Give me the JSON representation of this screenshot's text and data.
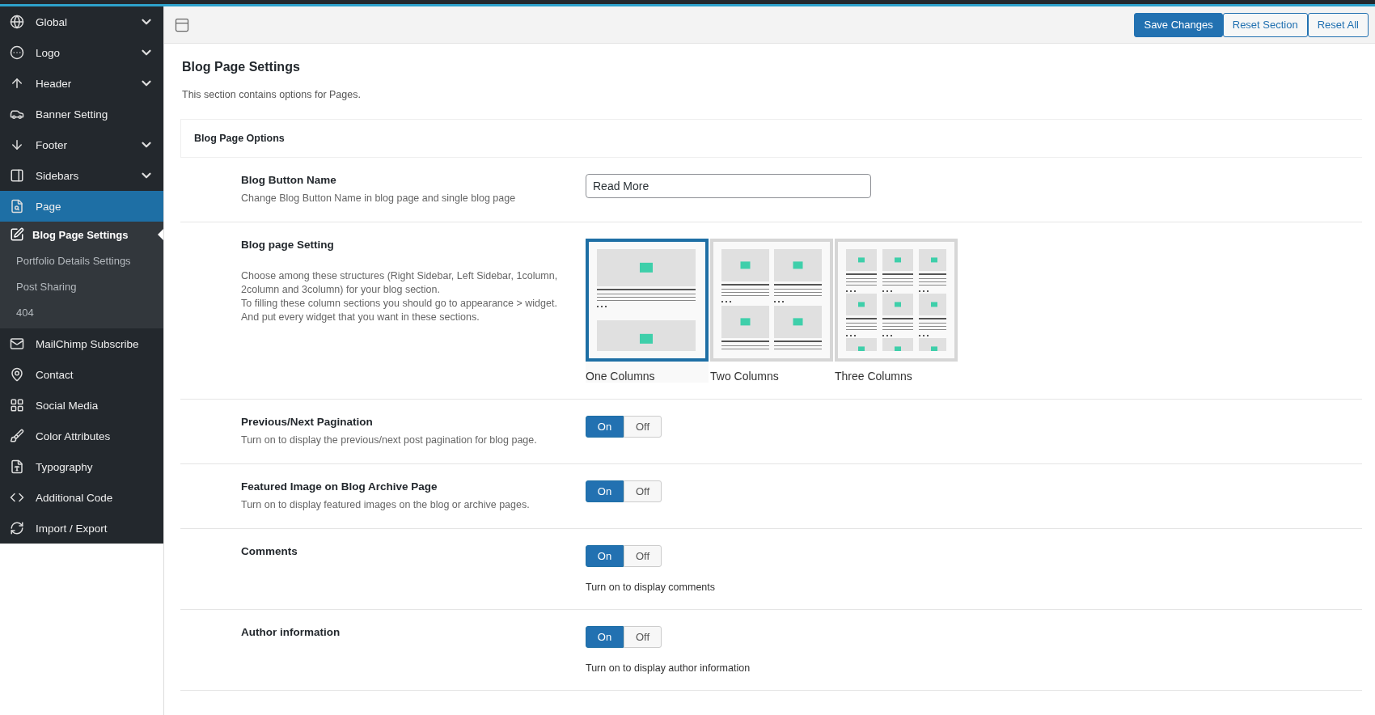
{
  "sidebar": {
    "items": [
      {
        "label": "Global",
        "expandable": true,
        "selected": false
      },
      {
        "label": "Logo",
        "expandable": true,
        "selected": false
      },
      {
        "label": "Header",
        "expandable": true,
        "selected": false
      },
      {
        "label": "Banner Setting",
        "expandable": false,
        "selected": false
      },
      {
        "label": "Footer",
        "expandable": true,
        "selected": false
      },
      {
        "label": "Sidebars",
        "expandable": true,
        "selected": false
      },
      {
        "label": "Page",
        "expandable": false,
        "selected": true,
        "children": [
          {
            "label": "Blog Page Settings",
            "selected": true
          },
          {
            "label": "Portfolio Details Settings",
            "selected": false
          },
          {
            "label": "Post Sharing",
            "selected": false
          },
          {
            "label": "404",
            "selected": false
          }
        ]
      },
      {
        "label": "MailChimp Subscribe",
        "expandable": false,
        "selected": false
      },
      {
        "label": "Contact",
        "expandable": false,
        "selected": false
      },
      {
        "label": "Social Media",
        "expandable": false,
        "selected": false
      },
      {
        "label": "Color Attributes",
        "expandable": false,
        "selected": false
      },
      {
        "label": "Typography",
        "expandable": false,
        "selected": false
      },
      {
        "label": "Additional Code",
        "expandable": false,
        "selected": false
      },
      {
        "label": "Import / Export",
        "expandable": false,
        "selected": false
      }
    ]
  },
  "toolbar": {
    "buttons": [
      {
        "label": "Save Changes",
        "kind": "primary"
      },
      {
        "label": "Reset Section",
        "kind": "secondary"
      },
      {
        "label": "Reset All",
        "kind": "secondary"
      }
    ]
  },
  "section": {
    "title": "Blog Page Settings",
    "description": "This section contains options for Pages.",
    "group": "Blog Page Options"
  },
  "settings": [
    {
      "kind": "text",
      "title": "Blog Button Name",
      "description": [
        "Change Blog Button Name in blog page and single blog page"
      ],
      "value": "Read More"
    },
    {
      "kind": "layout",
      "title": "Blog page Setting",
      "description": [
        "Choose among these structures (Right Sidebar, Left Sidebar, 1column, 2column and 3column) for your blog section.",
        "To filling these column sections you should go to appearance > widget.",
        "And put every widget that you want in these sections."
      ],
      "options": [
        {
          "label": "One Columns",
          "selected": true
        },
        {
          "label": "Two Columns",
          "selected": false
        },
        {
          "label": "Three Columns",
          "selected": false
        }
      ]
    },
    {
      "kind": "toggle",
      "title": "Previous/Next Pagination",
      "description": [
        "Turn on to display the previous/next post pagination for blog page."
      ],
      "on": true,
      "on_label": "On",
      "off_label": "Off"
    },
    {
      "kind": "toggle",
      "title": "Featured Image on Blog Archive Page",
      "description": [
        "Turn on to display featured images on the blog or archive pages."
      ],
      "on": true,
      "on_label": "On",
      "off_label": "Off"
    },
    {
      "kind": "toggle_note",
      "title": "Comments",
      "description": [
        "Turn on to display comments"
      ],
      "on": true,
      "on_label": "On",
      "off_label": "Off"
    },
    {
      "kind": "toggle_note",
      "title": "Author information",
      "description": [
        "Turn on to display author information"
      ],
      "on": true,
      "on_label": "On",
      "off_label": "Off"
    }
  ]
}
